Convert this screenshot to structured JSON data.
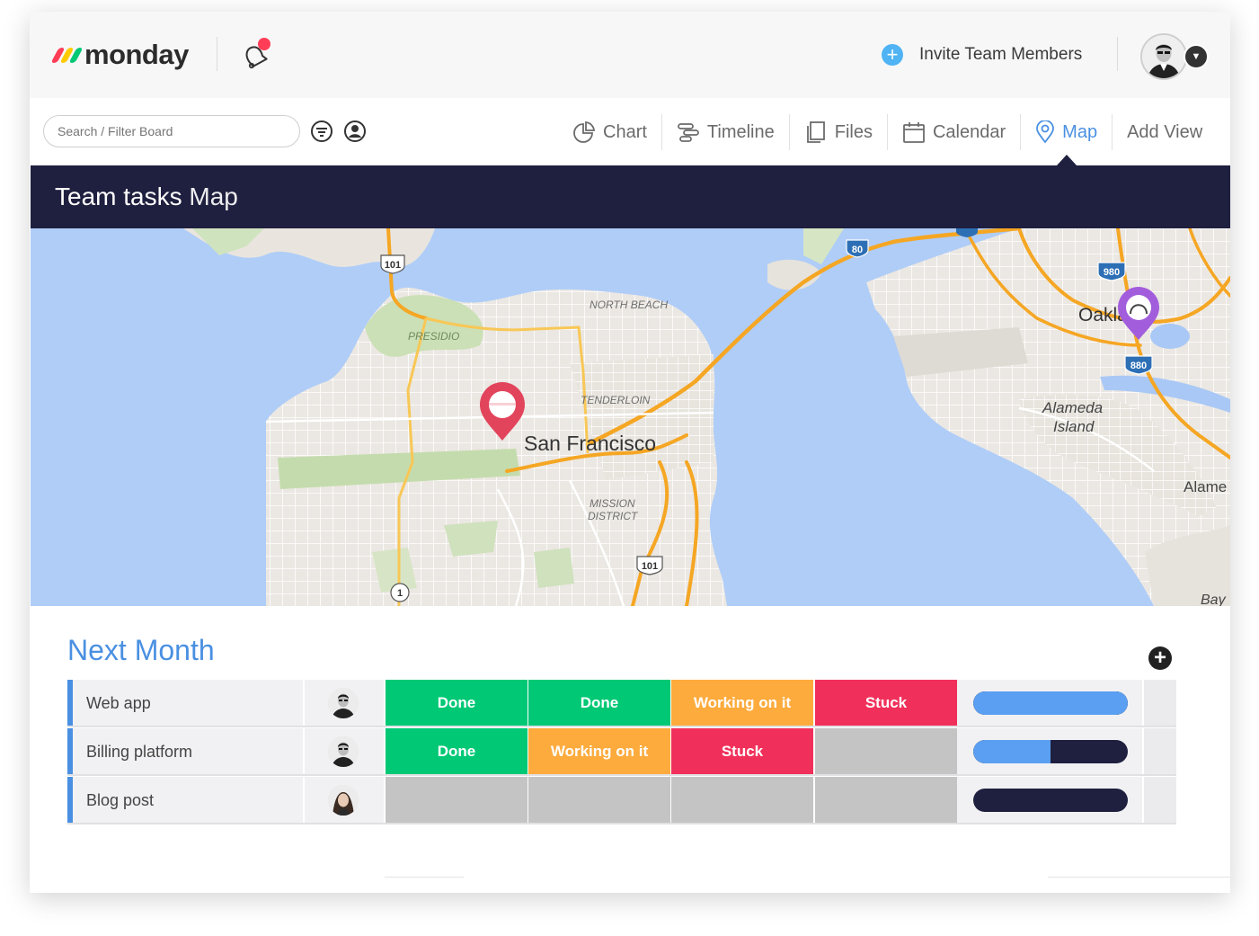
{
  "brand": {
    "name": "monday",
    "mark_colors": [
      "#ff3d57",
      "#ffcb00",
      "#00c875"
    ]
  },
  "topbar": {
    "invite_label": "Invite Team Members",
    "notification_dot_color": "#ff3d57"
  },
  "toolbar": {
    "search_placeholder": "Search / Filter Board",
    "views": [
      {
        "label": "Chart",
        "icon": "pie-chart-icon",
        "active": false
      },
      {
        "label": "Timeline",
        "icon": "timeline-icon",
        "active": false
      },
      {
        "label": "Files",
        "icon": "files-icon",
        "active": false
      },
      {
        "label": "Calendar",
        "icon": "calendar-icon",
        "active": false
      },
      {
        "label": "Map",
        "icon": "map-pin-icon",
        "active": true
      },
      {
        "label": "Add View",
        "icon": "",
        "active": false
      }
    ]
  },
  "board": {
    "name": "Team tasks",
    "view_name": "Map"
  },
  "map": {
    "labels": {
      "north_beach": "NORTH BEACH",
      "presidio": "PRESIDIO",
      "tenderloin": "TENDERLOIN",
      "san_francisco": "San Francisco",
      "mission_district_1": "MISSION",
      "mission_district_2": "DISTRICT",
      "oakland": "Oakland",
      "alameda_1": "Alameda",
      "alameda_2": "Island",
      "alame": "Alame",
      "bay": "Bay"
    },
    "shields": {
      "s101a": "101",
      "s101b": "101",
      "s80": "80",
      "s980": "980",
      "s880": "880",
      "s1": "1",
      "s60": "80"
    },
    "pins": [
      {
        "name": "red-pin",
        "color": "#e2445c"
      },
      {
        "name": "purple-pin",
        "color": "#a25ddc"
      }
    ]
  },
  "group": {
    "title": "Next Month",
    "accent": "#4a90e2",
    "rows": [
      {
        "name": "Web app",
        "statuses": [
          {
            "label": "Done",
            "color": "#00c875"
          },
          {
            "label": "Done",
            "color": "#00c875"
          },
          {
            "label": "Working on it",
            "color": "#fdab3d"
          },
          {
            "label": "Stuck",
            "color": "#f0305a"
          }
        ],
        "progress": 1.0
      },
      {
        "name": "Billing platform",
        "statuses": [
          {
            "label": "Done",
            "color": "#00c875"
          },
          {
            "label": "Working on it",
            "color": "#fdab3d"
          },
          {
            "label": "Stuck",
            "color": "#f0305a"
          },
          {
            "label": "",
            "color": "#c4c4c4"
          }
        ],
        "progress": 0.5
      },
      {
        "name": "Blog post",
        "statuses": [
          {
            "label": "",
            "color": "#c4c4c4"
          },
          {
            "label": "",
            "color": "#c4c4c4"
          },
          {
            "label": "",
            "color": "#c4c4c4"
          },
          {
            "label": "",
            "color": "#c4c4c4"
          }
        ],
        "progress": 0.0
      }
    ]
  }
}
